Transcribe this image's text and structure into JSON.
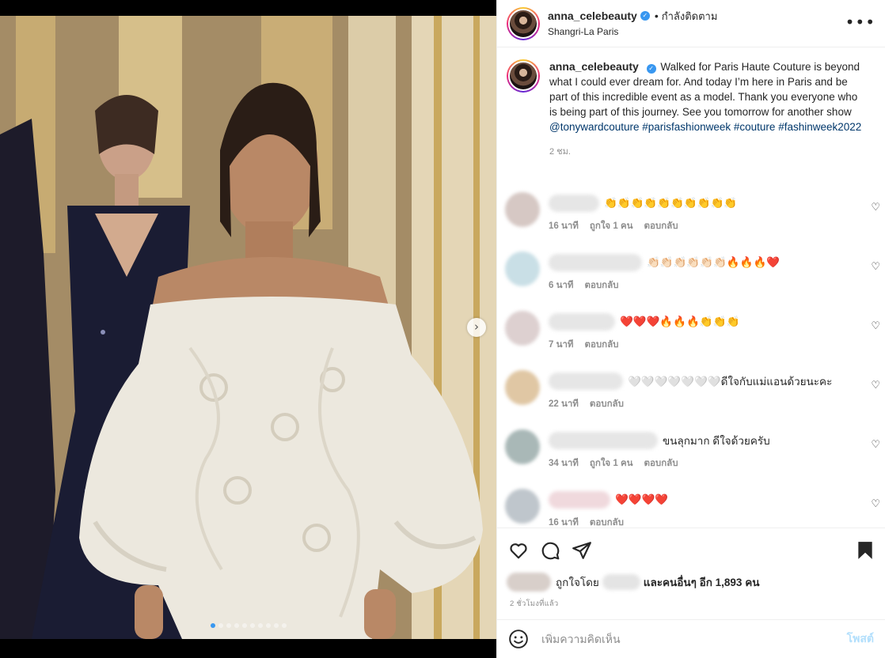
{
  "post": {
    "username": "anna_celebeauty",
    "verified_mark": "✓",
    "separator": "•",
    "following_label": "กำลังติดตาม",
    "location": "Shangri-La Paris",
    "more_icon": "more-horizontal-icon"
  },
  "photo": {
    "next_button": "›",
    "slide_count": 10,
    "active_slide": 1
  },
  "caption": {
    "username": "anna_celebeauty",
    "text": "Walked for Paris Haute Couture is beyond what I could ever dream for. And today I’m here in Paris and be part of this incredible event as a model. Thank you everyone who is being part of this journey. See you tomorrow for another show ",
    "tags": [
      "@tonywardcouture",
      "#parisfashionweek",
      "#couture",
      "#fashinweek2022"
    ],
    "time": "2 ชม."
  },
  "comments": [
    {
      "text": "👏👏👏👏👏👏👏👏👏👏",
      "time": "16 นาที",
      "likes": "ถูกใจ 1 คน",
      "reply": "ตอบกลับ"
    },
    {
      "text": "👏🏻👏🏻👏🏻👏🏻👏🏻👏🏻🔥🔥🔥❤️",
      "time": "6 นาที",
      "likes": "",
      "reply": "ตอบกลับ"
    },
    {
      "text": "❤️❤️❤️🔥🔥🔥👏👏👏",
      "time": "7 นาที",
      "likes": "",
      "reply": "ตอบกลับ"
    },
    {
      "text": "🤍🤍🤍🤍🤍🤍🤍ดีใจกับแม่แอนด้วยนะคะ",
      "time": "22 นาที",
      "likes": "",
      "reply": "ตอบกลับ"
    },
    {
      "text": "ขนลุกมาก ดีใจด้วยครับ",
      "time": "34 นาที",
      "likes": "ถูกใจ 1 คน",
      "reply": "ตอบกลับ"
    },
    {
      "text": "❤️❤️❤️❤️",
      "time": "16 นาที",
      "likes": "",
      "reply": "ตอบกลับ"
    }
  ],
  "actions": {
    "liked_by": "ถูกใจโดย",
    "and_others": "และคนอื่นๆ อีก",
    "like_count": "1,893",
    "people_suffix": "คน",
    "posted_ago": "2 ชั่วโมงที่แล้ว"
  },
  "comment_box": {
    "placeholder": "เพิ่มความคิดเห็น",
    "post_label": "โพสต์"
  },
  "colors": {
    "accent": "#3897f0",
    "hashtag": "#00376b",
    "muted": "#8e8e8e",
    "post_disabled": "#b2dffc"
  }
}
